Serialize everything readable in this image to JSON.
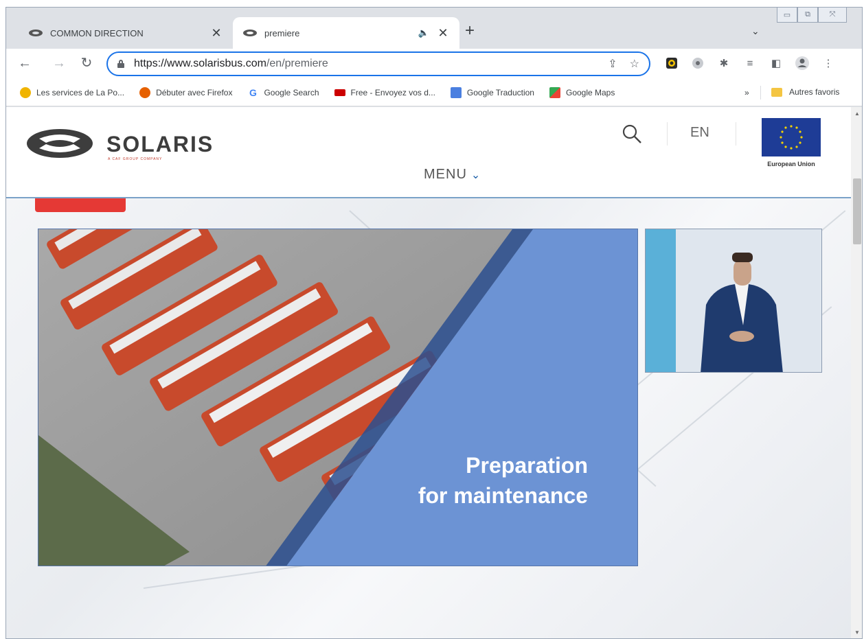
{
  "browser": {
    "tabs": [
      {
        "title": "COMMON DIRECTION",
        "close": "✕"
      },
      {
        "title": "premiere",
        "close": "✕",
        "audio": "🔈"
      }
    ],
    "new_tab": "+",
    "tab_dropdown": "⌄",
    "window_controls": {
      "minimize": "▭",
      "restore": "⧉",
      "close": "⤧"
    },
    "url_host": "https://www.solarisbus.com",
    "url_path": "/en/premiere",
    "nav": {
      "back": "←",
      "forward": "→",
      "reload": "↻"
    },
    "omnibox_icons": {
      "share": "⇪",
      "bookmark": "☆"
    },
    "toolbar_icons": {
      "extensions": "✱",
      "reading_list": "≡",
      "side_panel": "◧",
      "menu": "⋮"
    },
    "bookmarks": [
      {
        "label": "Les services de La Po...",
        "color": "#f0b400"
      },
      {
        "label": "Débuter avec Firefox",
        "color": "#e66000"
      },
      {
        "label": "Google Search",
        "color": "#4285f4"
      },
      {
        "label": "Free - Envoyez vos d...",
        "color": "#cc0000"
      },
      {
        "label": "Google Traduction",
        "color": "#4a7fe0"
      },
      {
        "label": "Google Maps",
        "color": "#34a853"
      }
    ],
    "bookmarks_more": "»",
    "other_bookmarks": "Autres favoris"
  },
  "site": {
    "logo": "SOLARIS",
    "logo_sub": "A CAF GROUP COMPANY",
    "language": "EN",
    "eu_label": "European Union",
    "menu_label": "MENU",
    "menu_chevron": "⌄",
    "slide_title_line1": "Preparation",
    "slide_title_line2": "for maintenance"
  },
  "scrollbar": {
    "up": "▲",
    "down": "▼"
  }
}
